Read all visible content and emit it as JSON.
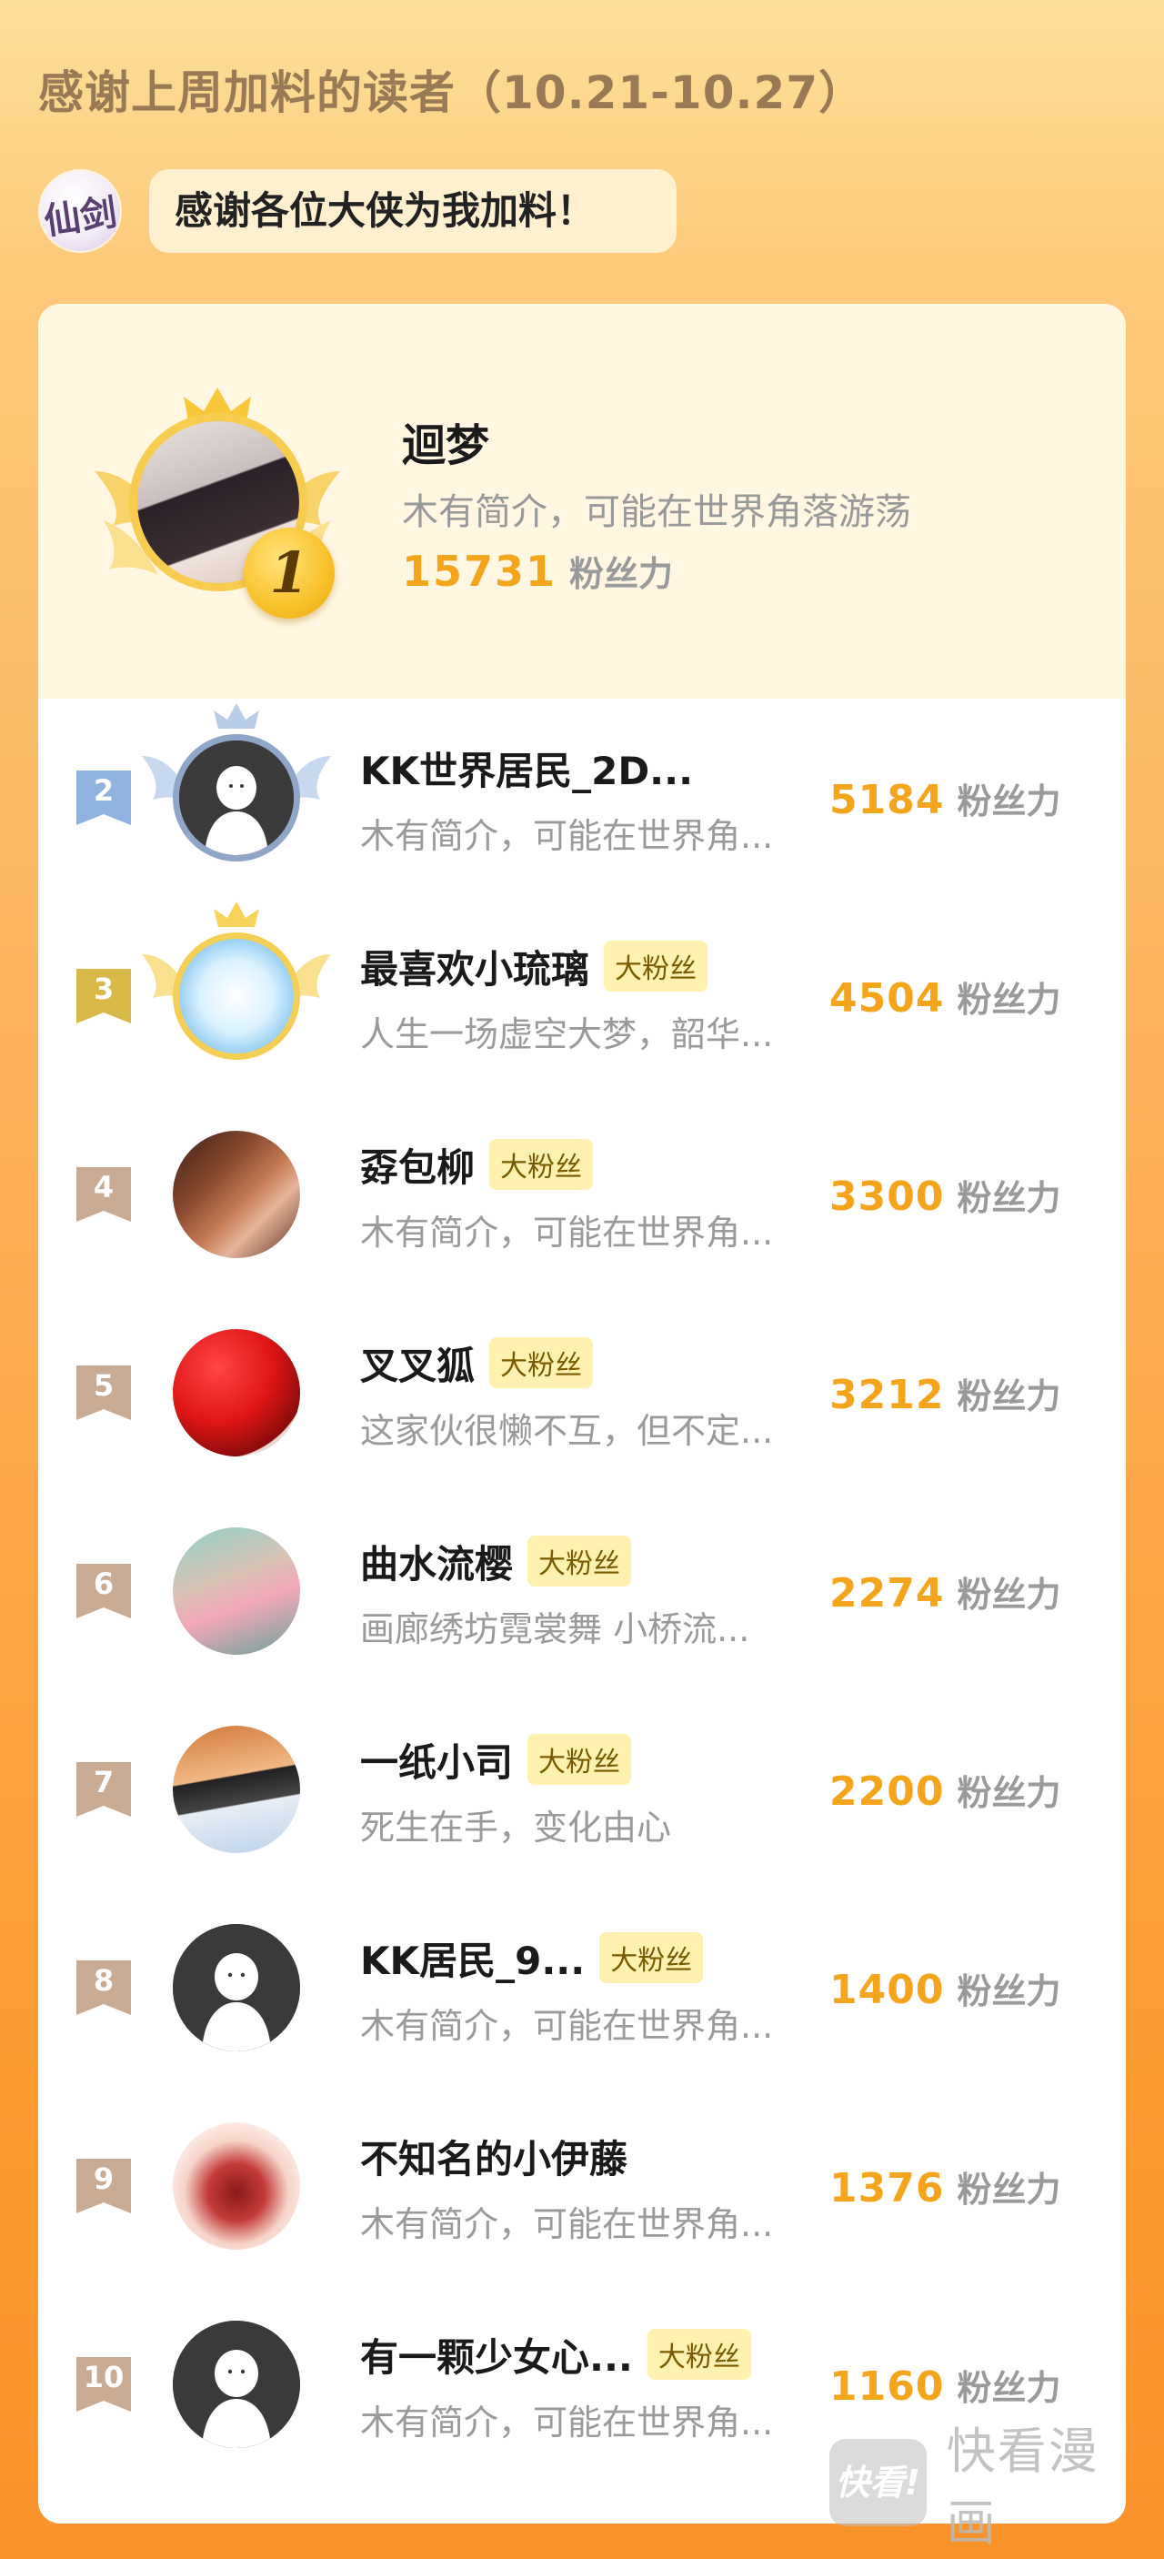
{
  "header": {
    "title": "感谢上周加料的读者（10.21-10.27）",
    "intro_avatar_text": "仙剑",
    "speech": "感谢各位大侠为我加料！"
  },
  "top_fan": {
    "rank": "1",
    "name": "迴梦",
    "bio": "木有简介，可能在世界角落游荡",
    "score": "15731",
    "score_unit": "粉丝力"
  },
  "list": [
    {
      "rank": "2",
      "name": "KK世界居民_2D...",
      "badge": "",
      "bio": "木有简介，可能在世界角...",
      "score": "5184",
      "unit": "粉丝力"
    },
    {
      "rank": "3",
      "name": "最喜欢小琉璃",
      "badge": "大粉丝",
      "bio": "人生一场虚空大梦，韶华...",
      "score": "4504",
      "unit": "粉丝力"
    },
    {
      "rank": "4",
      "name": "孬包柳",
      "badge": "大粉丝",
      "bio": "木有简介，可能在世界角...",
      "score": "3300",
      "unit": "粉丝力"
    },
    {
      "rank": "5",
      "name": "叉叉狐",
      "badge": "大粉丝",
      "bio": "这家伙很懒不互，但不定...",
      "score": "3212",
      "unit": "粉丝力"
    },
    {
      "rank": "6",
      "name": "曲水流樱",
      "badge": "大粉丝",
      "bio": "画廊绣坊霓裳舞 小桥流...",
      "score": "2274",
      "unit": "粉丝力"
    },
    {
      "rank": "7",
      "name": "一纸小司",
      "badge": "大粉丝",
      "bio": "死生在手，变化由心",
      "score": "2200",
      "unit": "粉丝力"
    },
    {
      "rank": "8",
      "name": "KK居民_9...",
      "badge": "大粉丝",
      "bio": "木有简介，可能在世界角...",
      "score": "1400",
      "unit": "粉丝力"
    },
    {
      "rank": "9",
      "name": "不知名的小伊藤",
      "badge": "",
      "bio": "木有简介，可能在世界角...",
      "score": "1376",
      "unit": "粉丝力"
    },
    {
      "rank": "10",
      "name": "有一颗少女心...",
      "badge": "大粉丝",
      "bio": "木有简介，可能在世界角...",
      "score": "1160",
      "unit": "粉丝力"
    }
  ],
  "watermark": {
    "logo_text": "快看!",
    "text": "快看漫画"
  },
  "colors": {
    "score": "#f4a51c",
    "rank_silver": "#8fb2de",
    "rank_gold": "#d9b84a",
    "rank_other": "#c9ab93",
    "badge_bg": "#fff1b0"
  }
}
